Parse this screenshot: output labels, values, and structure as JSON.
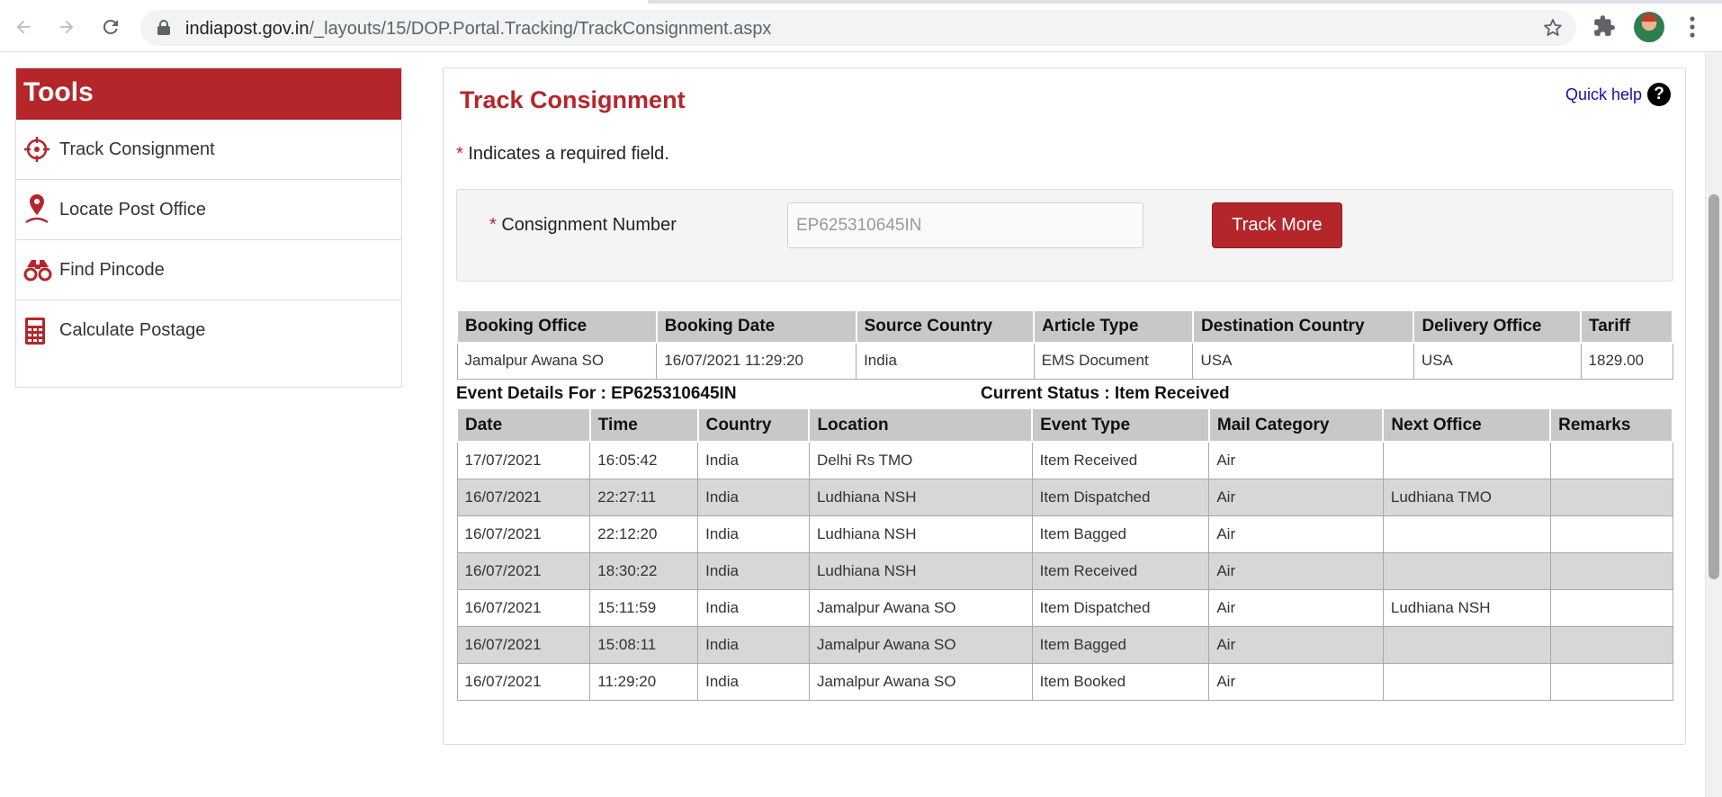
{
  "browser": {
    "url_domain": "indiapost.gov.in",
    "url_path": "/_layouts/15/DOP.Portal.Tracking/TrackConsignment.aspx"
  },
  "sidebar": {
    "title": "Tools",
    "items": [
      {
        "label": "Track Consignment",
        "icon": "crosshair-icon"
      },
      {
        "label": "Locate Post Office",
        "icon": "map-pin-icon"
      },
      {
        "label": "Find Pincode",
        "icon": "binoculars-icon"
      },
      {
        "label": "Calculate Postage",
        "icon": "calculator-icon"
      }
    ]
  },
  "main": {
    "title": "Track Consignment",
    "quick_help": "Quick help",
    "quick_help_icon": "?",
    "required_star": "*",
    "required_note": "Indicates a required field.",
    "form": {
      "label": "Consignment Number",
      "input_value": "EP625310645IN",
      "button": "Track More"
    },
    "booking": {
      "headers": [
        "Booking Office",
        "Booking Date",
        "Source Country",
        "Article Type",
        "Destination Country",
        "Delivery Office",
        "Tariff"
      ],
      "row": [
        "Jamalpur Awana SO",
        "16/07/2021 11:29:20",
        "India",
        "EMS Document",
        "USA",
        "USA",
        "1829.00"
      ]
    },
    "event_details": "Event Details For : EP625310645IN",
    "current_status": "Current Status : Item Received",
    "events": {
      "headers": [
        "Date",
        "Time",
        "Country",
        "Location",
        "Event Type",
        "Mail Category",
        "Next Office",
        "Remarks"
      ],
      "rows": [
        [
          "17/07/2021",
          "16:05:42",
          "India",
          "Delhi Rs TMO",
          "Item Received",
          "Air",
          "",
          ""
        ],
        [
          "16/07/2021",
          "22:27:11",
          "India",
          "Ludhiana NSH",
          "Item Dispatched",
          "Air",
          "Ludhiana TMO",
          ""
        ],
        [
          "16/07/2021",
          "22:12:20",
          "India",
          "Ludhiana NSH",
          "Item Bagged",
          "Air",
          "",
          ""
        ],
        [
          "16/07/2021",
          "18:30:22",
          "India",
          "Ludhiana NSH",
          "Item Received",
          "Air",
          "",
          ""
        ],
        [
          "16/07/2021",
          "15:11:59",
          "India",
          "Jamalpur Awana SO",
          "Item Dispatched",
          "Air",
          "Ludhiana NSH",
          ""
        ],
        [
          "16/07/2021",
          "15:08:11",
          "India",
          "Jamalpur Awana SO",
          "Item Bagged",
          "Air",
          "",
          ""
        ],
        [
          "16/07/2021",
          "11:29:20",
          "India",
          "Jamalpur Awana SO",
          "Item Booked",
          "Air",
          "",
          ""
        ]
      ]
    }
  },
  "colors": {
    "brand_red": "#b5262a",
    "header_gray": "#c8c8c8",
    "alt_row": "#d8d6d6"
  }
}
